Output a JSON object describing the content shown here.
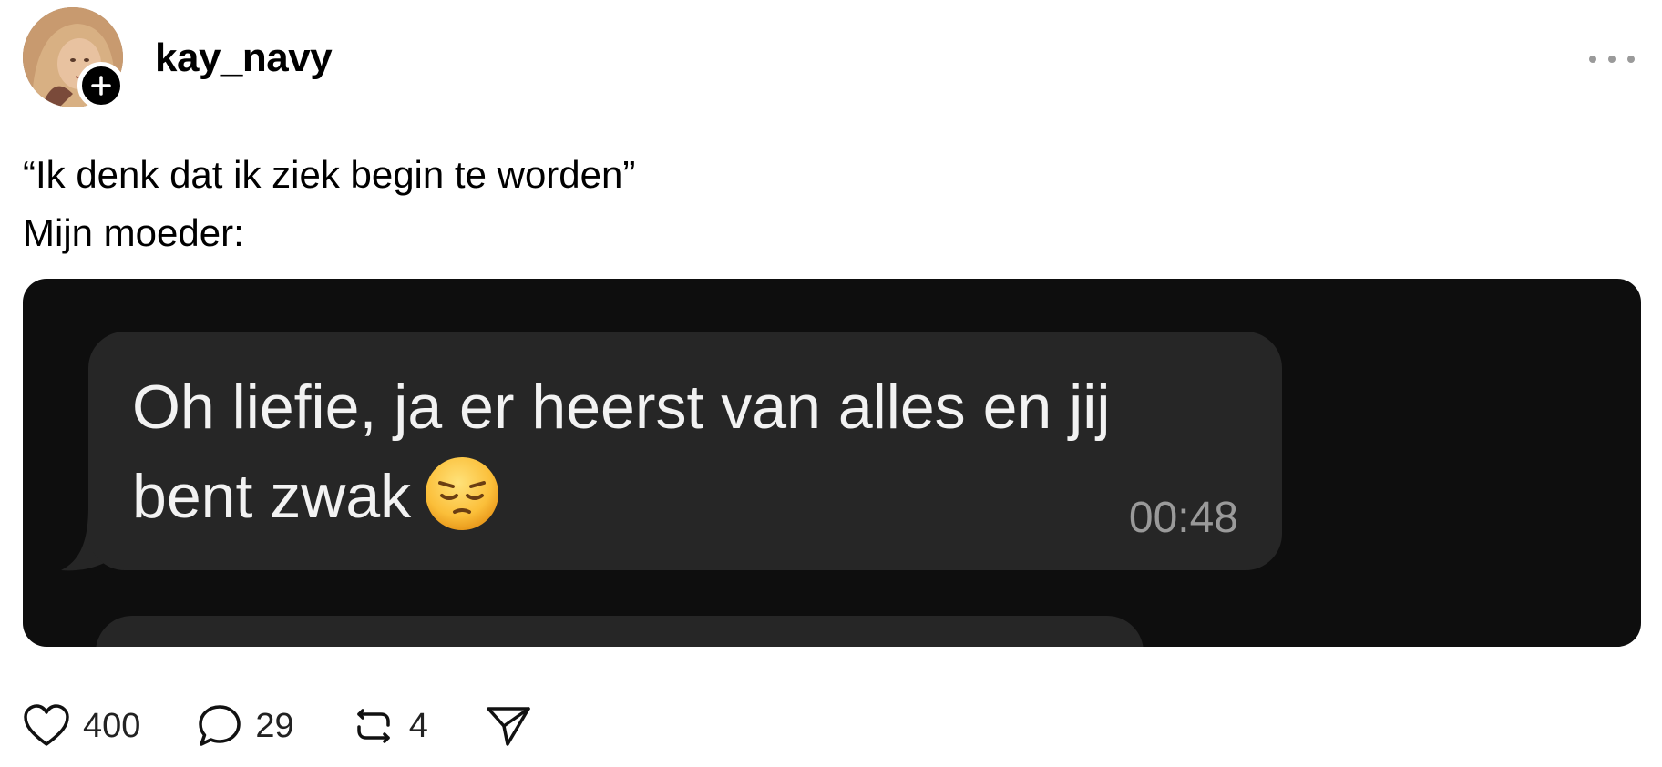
{
  "post": {
    "username": "kay_navy",
    "caption_lines": [
      "“Ik denk dat ik ziek begin te worden”",
      "Mijn moeder:"
    ]
  },
  "media": {
    "message_lines": [
      "Oh liefie, ja er heerst van alles en jij",
      "bent zwak"
    ],
    "emoji": "pensive-face",
    "timestamp": "00:48"
  },
  "actions": {
    "likes": "400",
    "replies": "29",
    "reposts": "4"
  },
  "colors": {
    "background": "#ffffff",
    "media_background": "#0e0e0e",
    "bubble": "#262626",
    "muted": "#9a9a9a"
  }
}
